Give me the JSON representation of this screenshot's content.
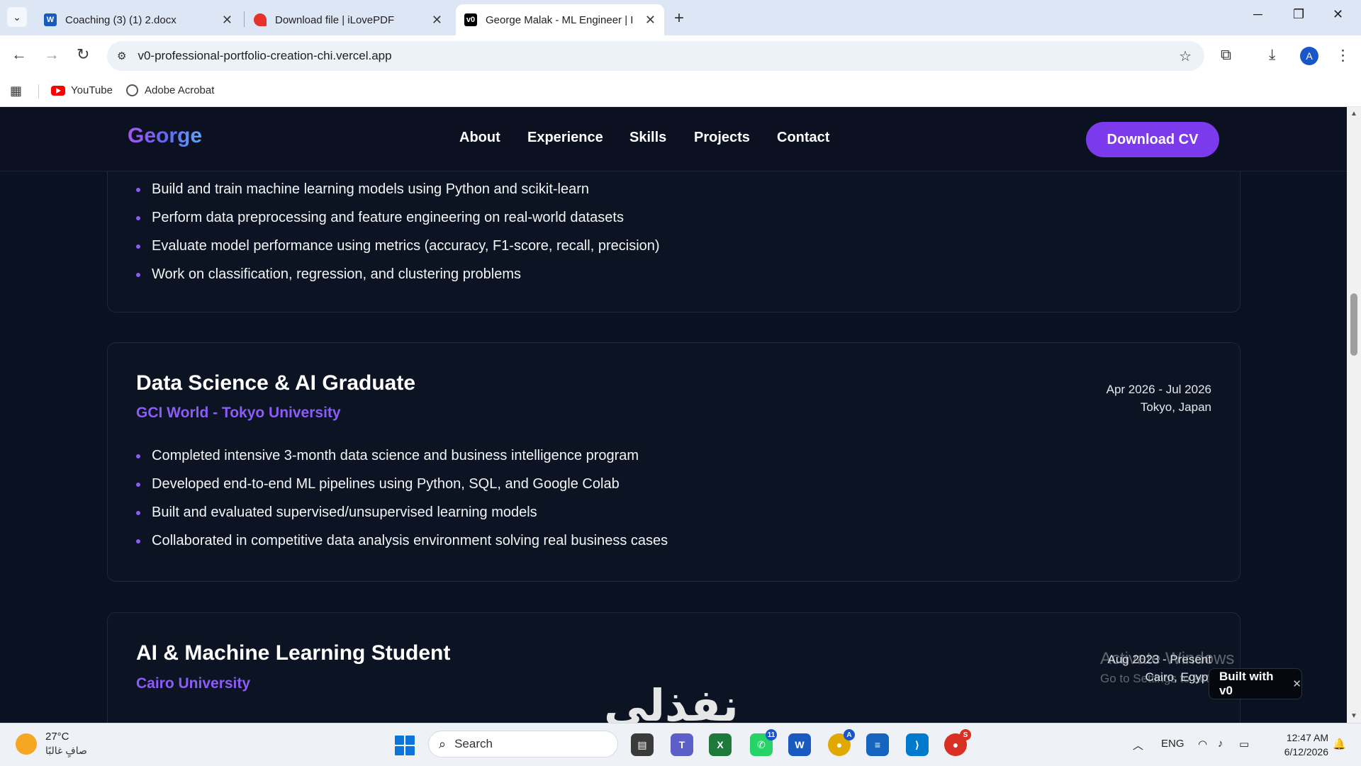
{
  "browser": {
    "tabs": [
      {
        "title": "Coaching (3) (1) 2.docx",
        "active": false
      },
      {
        "title": "Download file | iLovePDF",
        "active": false
      },
      {
        "title": "George Malak - ML Engineer | I",
        "active": true
      }
    ],
    "url": "v0-professional-portfolio-creation-chi.vercel.app",
    "bookmarks": [
      {
        "label": "YouTube"
      },
      {
        "label": "Adobe Acrobat"
      }
    ],
    "profile_initial": "A"
  },
  "site": {
    "logo": "George",
    "nav": [
      "About",
      "Experience",
      "Skills",
      "Projects",
      "Contact"
    ],
    "cta": "Download CV"
  },
  "experience": [
    {
      "bullets": [
        "Build and train machine learning models using Python and scikit-learn",
        "Perform data preprocessing and feature engineering on real-world datasets",
        "Evaluate model performance using metrics (accuracy, F1-score, recall, precision)",
        "Work on classification, regression, and clustering problems"
      ]
    },
    {
      "role": "Data Science & AI Graduate",
      "org": "GCI World - Tokyo University",
      "dates": "Apr 2026 - Jul 2026",
      "location": "Tokyo, Japan",
      "bullets": [
        "Completed intensive 3-month data science and business intelligence program",
        "Developed end-to-end ML pipelines using Python, SQL, and Google Colab",
        "Built and evaluated supervised/unsupervised learning models",
        "Collaborated in competitive data analysis environment solving real business cases"
      ]
    },
    {
      "role": "AI & Machine Learning Student",
      "org": "Cairo University",
      "dates": "Aug 2023 - Present",
      "location": "Cairo, Egypt"
    }
  ],
  "overlays": {
    "activate_title": "Activate Windows",
    "activate_sub": "Go to Settings to activate Windows.",
    "built_with": "Built with v0",
    "watermark": "نفذلي"
  },
  "taskbar": {
    "temp": "27°C",
    "weather": "صافٍ غالبًا",
    "search_label": "Search",
    "whatsapp_badge": "11",
    "chrome_badge": "A",
    "chrome2_badge": "S",
    "lang": "ENG",
    "time": "12:47 AM",
    "date": "6/12/2026"
  },
  "colors": {
    "accent": "#7c3aed",
    "org_text": "#8b5cf6",
    "page_bg": "#0a1120"
  }
}
